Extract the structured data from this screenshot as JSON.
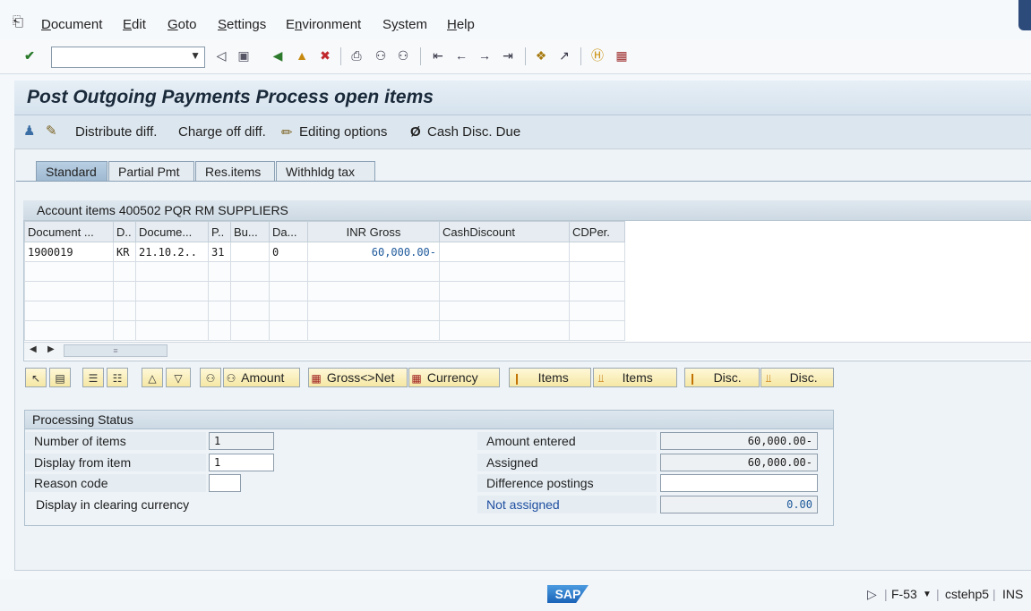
{
  "menu": {
    "items": [
      "Document",
      "Edit",
      "Goto",
      "Settings",
      "Environment",
      "System",
      "Help"
    ],
    "underline": [
      "D",
      "E",
      "G",
      "S",
      "n",
      "y",
      "H"
    ]
  },
  "toolbar": {
    "command_value": "",
    "icons": [
      "check-icon",
      "back-triangle-icon",
      "save-icon",
      "back-icon",
      "exit-icon",
      "cancel-icon",
      "print-icon",
      "find-icon",
      "find-next-icon",
      "first-page-icon",
      "prev-page-icon",
      "next-page-icon",
      "last-page-icon",
      "new-session-icon",
      "shortcut-icon",
      "help-icon",
      "layout-icon"
    ]
  },
  "title": "Post Outgoing Payments Process open items",
  "app_toolbar": {
    "distribute": "Distribute diff.",
    "charge_off": "Charge off diff.",
    "editing_options": "Editing options",
    "cash_disc_due": "Cash Disc. Due"
  },
  "tabs": [
    "Standard",
    "Partial Pmt",
    "Res.items",
    "Withhldg tax"
  ],
  "grid": {
    "title": "Account items 400502 PQR RM SUPPLIERS",
    "columns": [
      "Document ...",
      "D..",
      "Docume...",
      "P..",
      "Bu...",
      "Da...",
      "INR Gross",
      "CashDiscount",
      "CDPer."
    ],
    "rows": [
      [
        "1900019",
        "KR",
        "21.10.2..",
        "31",
        "",
        "0",
        "60,000.00-",
        "",
        ""
      ]
    ]
  },
  "buttons": {
    "amount": "Amount",
    "gross_net": "Gross<>Net",
    "currency": "Currency",
    "items1": "Items",
    "items2": "Items",
    "disc1": "Disc.",
    "disc2": "Disc."
  },
  "processing_status": {
    "title": "Processing Status",
    "number_of_items_label": "Number of items",
    "number_of_items": "1",
    "display_from_label": "Display from item",
    "display_from": "1",
    "reason_code_label": "Reason code",
    "reason_code": "",
    "display_clearing_label": "Display in clearing currency",
    "amount_entered_label": "Amount entered",
    "amount_entered": "60,000.00-",
    "assigned_label": "Assigned",
    "assigned": "60,000.00-",
    "difference_label": "Difference postings",
    "difference": "",
    "not_assigned_label": "Not assigned",
    "not_assigned": "0.00"
  },
  "statusbar": {
    "logo": "SAP",
    "transaction": "F-53",
    "server": "cstehp5",
    "mode": "INS"
  }
}
